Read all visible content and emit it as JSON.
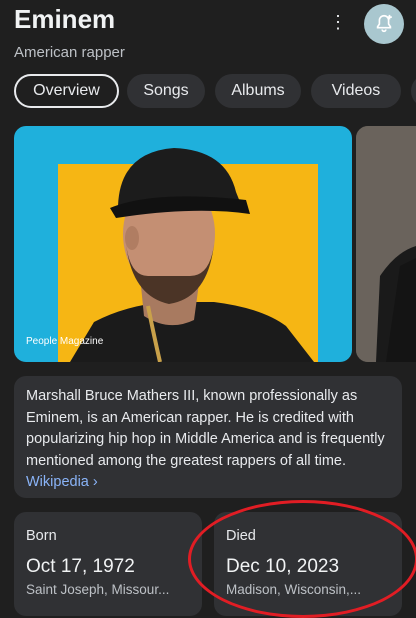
{
  "entity": {
    "title": "Eminem",
    "subtitle": "American rapper"
  },
  "icons": {
    "more": "more-vert-icon",
    "bell": "bell-add-icon"
  },
  "tabs": [
    {
      "label": "Overview",
      "active": true
    },
    {
      "label": "Songs",
      "active": false
    },
    {
      "label": "Albums",
      "active": false
    },
    {
      "label": "Videos",
      "active": false
    }
  ],
  "hero": {
    "credit": "People Magazine"
  },
  "description": {
    "text": "Marshall Bruce Mathers III, known professionally as Eminem, is an American rapper. He is credited with popularizing hip hop in Middle America and is frequently mentioned among the greatest rappers of all time.",
    "link_label": "Wikipedia ›"
  },
  "facts": {
    "born": {
      "label": "Born",
      "date": "Oct 17, 1972",
      "place": "Saint Joseph, Missour..."
    },
    "died": {
      "label": "Died",
      "date": "Dec 10, 2023",
      "place": "Madison, Wisconsin,..."
    }
  },
  "colors": {
    "background": "#1f1f1f",
    "card": "#303134",
    "link": "#8ab4f8",
    "highlight": "#e11d24",
    "bell_button": "#a9c7cf"
  }
}
